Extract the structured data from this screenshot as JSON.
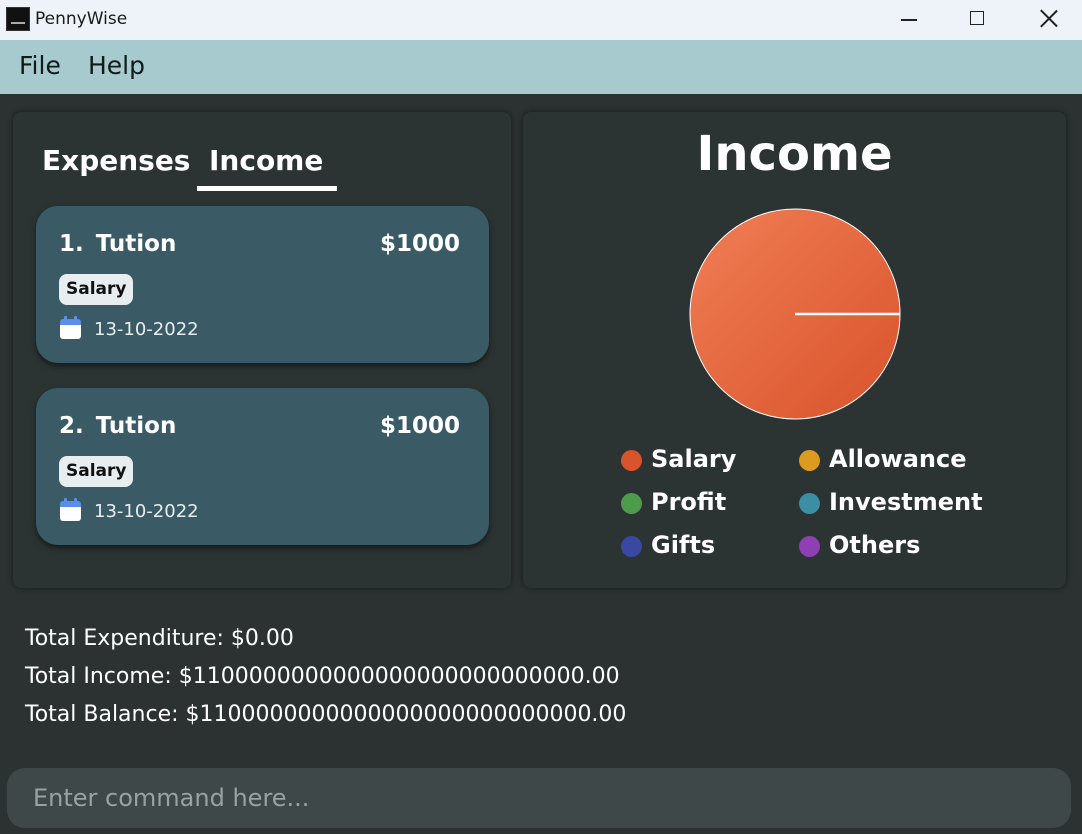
{
  "window": {
    "title": "PennyWise",
    "controls": {
      "minimize": "minimize-icon",
      "maximize": "maximize-icon",
      "close": "close-icon"
    }
  },
  "menu": {
    "items": [
      "File",
      "Help"
    ]
  },
  "tabs": {
    "items": [
      "Expenses",
      "Income"
    ],
    "selected": "Income"
  },
  "entries": [
    {
      "index": "1.",
      "title": "Tution",
      "amount": "$1000",
      "tag": "Salary",
      "date": "13-10-2022"
    },
    {
      "index": "2.",
      "title": "Tution",
      "amount": "$1000",
      "tag": "Salary",
      "date": "13-10-2022"
    }
  ],
  "chart_data": {
    "type": "pie",
    "title": "Income",
    "slices": [
      {
        "name": "Salary",
        "value": 100,
        "color": "#e0582f"
      }
    ],
    "legend_position": "bottom",
    "legend": [
      {
        "name": "Salary",
        "color": "#d9532b"
      },
      {
        "name": "Allowance",
        "color": "#dc9a1f"
      },
      {
        "name": "Profit",
        "color": "#4f9b4c"
      },
      {
        "name": "Investment",
        "color": "#3b8ea4"
      },
      {
        "name": "Gifts",
        "color": "#3949a3"
      },
      {
        "name": "Others",
        "color": "#8e3fb3"
      }
    ]
  },
  "totals": {
    "expenditure": "Total Expenditure: $0.00",
    "income": "Total Income: $1100000000000000000000000000.00",
    "balance": "Total Balance: $1100000000000000000000000000.00"
  },
  "command": {
    "placeholder": "Enter command here..."
  },
  "colors": {
    "menu_bar": "#a6cacd",
    "card": "#3a5b66",
    "background": "#2c3232",
    "panel": "#2b3333"
  }
}
